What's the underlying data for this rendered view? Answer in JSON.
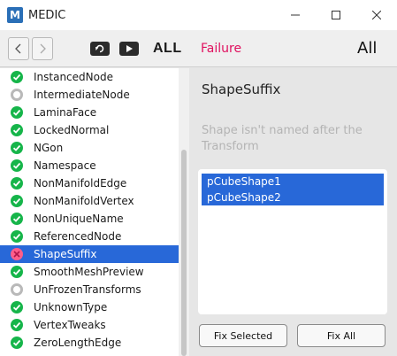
{
  "window": {
    "title": "MEDIC",
    "logo_letter": "M",
    "controls": [
      "minimize-icon",
      "maximize-icon",
      "close-icon"
    ]
  },
  "toolbar": {
    "back_icon": "chevron-left-icon",
    "forward_icon": "chevron-right-icon",
    "reload_icon": "reload-icon",
    "play_icon": "play-icon",
    "filter_all_label": "ALL",
    "filter_failure_label": "Failure",
    "filter_all_right_label": "All",
    "failure_color": "#e0115f"
  },
  "tests": [
    {
      "label": "InstancedNode",
      "status": "ok"
    },
    {
      "label": "IntermediateNode",
      "status": "skip"
    },
    {
      "label": "LaminaFace",
      "status": "ok"
    },
    {
      "label": "LockedNormal",
      "status": "ok"
    },
    {
      "label": "NGon",
      "status": "ok"
    },
    {
      "label": "Namespace",
      "status": "ok"
    },
    {
      "label": "NonManifoldEdge",
      "status": "ok"
    },
    {
      "label": "NonManifoldVertex",
      "status": "ok"
    },
    {
      "label": "NonUniqueName",
      "status": "ok"
    },
    {
      "label": "ReferencedNode",
      "status": "ok"
    },
    {
      "label": "ShapeSuffix",
      "status": "fail",
      "selected": true
    },
    {
      "label": "SmoothMeshPreview",
      "status": "ok"
    },
    {
      "label": "UnFrozenTransforms",
      "status": "skip"
    },
    {
      "label": "UnknownType",
      "status": "ok"
    },
    {
      "label": "VertexTweaks",
      "status": "ok"
    },
    {
      "label": "ZeroLengthEdge",
      "status": "ok"
    }
  ],
  "status_colors": {
    "ok": "#16b54a",
    "skip": "#b9b9b9",
    "fail": "#ff5e8a",
    "selected": "#2868d8"
  },
  "detail": {
    "title": "ShapeSuffix",
    "description": "Shape isn't named after the Transform",
    "nodes": [
      "pCubeShape1",
      "pCubeShape2"
    ],
    "fix_selected_label": "Fix Selected",
    "fix_all_label": "Fix All"
  }
}
